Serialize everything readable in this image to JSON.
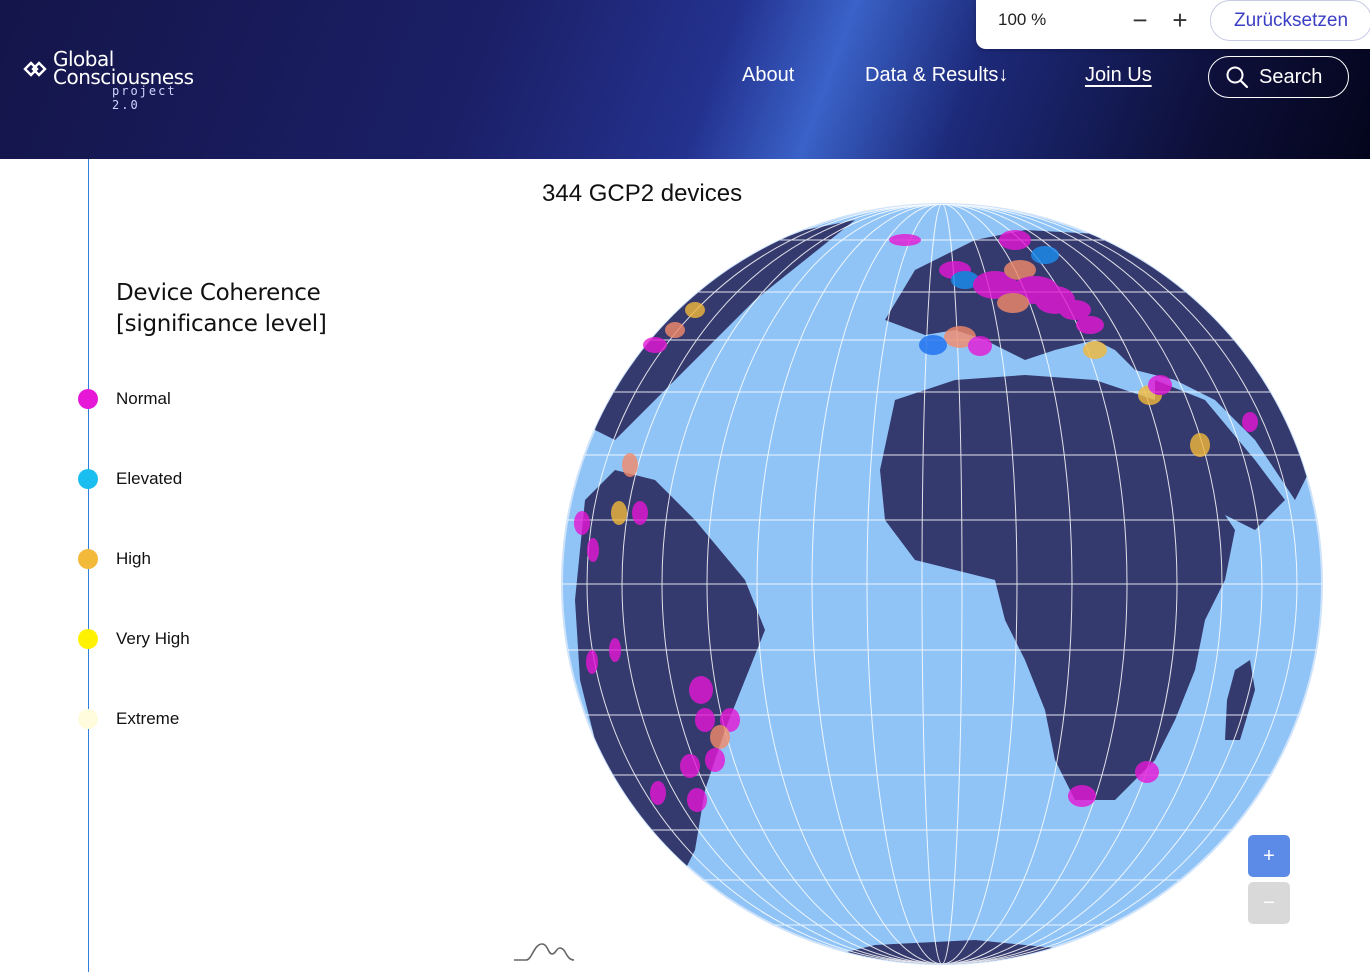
{
  "header": {
    "logo": {
      "line1": "Global",
      "line2": "Consciousness",
      "sub": "project 2.0"
    },
    "nav": {
      "about": "About",
      "data_results": "Data & Results",
      "data_results_arrow": "↓",
      "join_us": "Join Us",
      "search": "Search"
    }
  },
  "zoom_bar": {
    "value": "100 %",
    "minus": "−",
    "plus": "+",
    "reset": "Zurücksetzen"
  },
  "legend": {
    "title_line1": "Device Coherence",
    "title_line2": "[significance level]",
    "items": [
      {
        "label": "Normal",
        "color": "#e617d6"
      },
      {
        "label": "Elevated",
        "color": "#1bbef0"
      },
      {
        "label": "High",
        "color": "#f3b93b"
      },
      {
        "label": "Very High",
        "color": "#fff200"
      },
      {
        "label": "Extreme",
        "color": "#fffbdd"
      }
    ]
  },
  "map": {
    "title": "344 GCP2 devices",
    "ocean_color": "#90c4f7",
    "land_color": "#353a6e",
    "zoom_in": "+",
    "zoom_out": "−"
  }
}
